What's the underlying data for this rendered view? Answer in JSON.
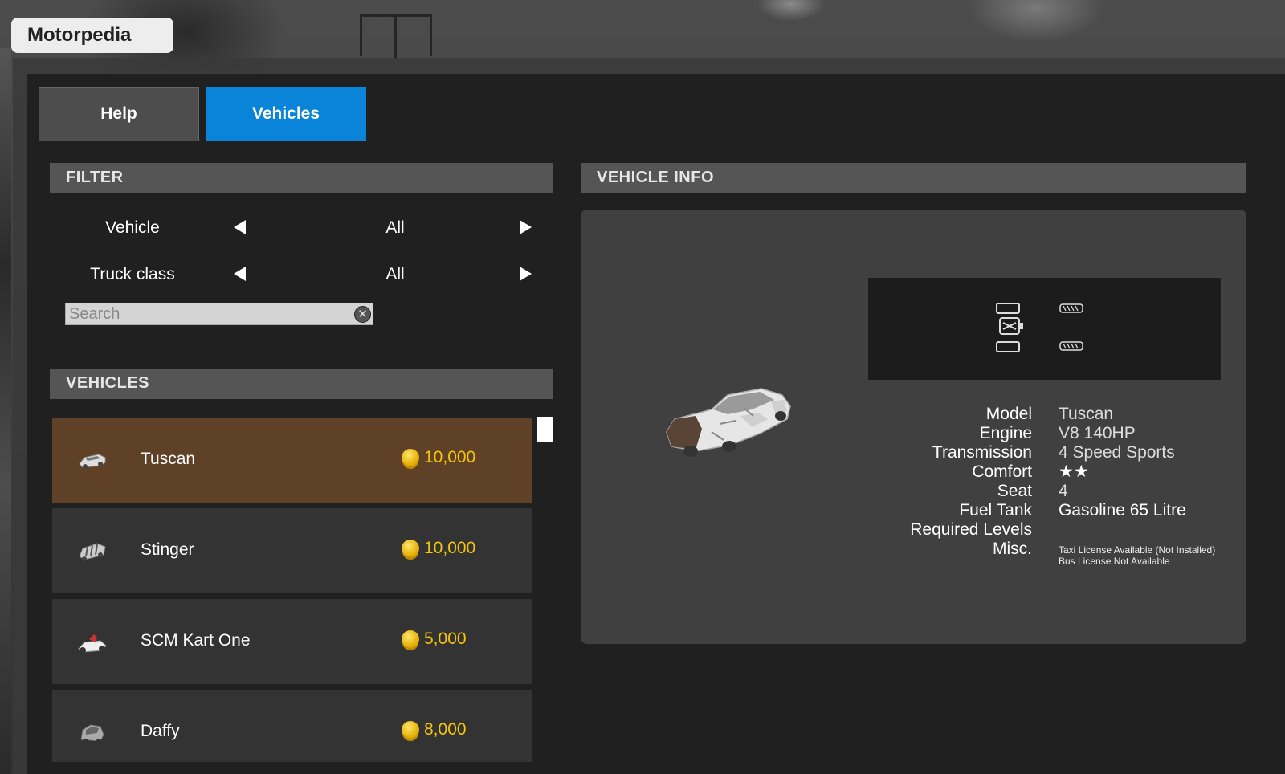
{
  "window": {
    "title": "Motorpedia"
  },
  "tabs": [
    {
      "label": "Help",
      "active": false
    },
    {
      "label": "Vehicles",
      "active": true
    }
  ],
  "filter": {
    "header": "FILTER",
    "rows": [
      {
        "label": "Vehicle",
        "value": "All"
      },
      {
        "label": "Truck class",
        "value": "All"
      }
    ],
    "search_placeholder": "Search"
  },
  "vehicles": {
    "header": "VEHICLES",
    "items": [
      {
        "name": "Tuscan",
        "price": "10,000",
        "selected": true
      },
      {
        "name": "Stinger",
        "price": "10,000",
        "selected": false
      },
      {
        "name": "SCM Kart One",
        "price": "5,000",
        "selected": false
      },
      {
        "name": "Daffy",
        "price": "8,000",
        "selected": false
      }
    ]
  },
  "vehicle_info": {
    "header": "VEHICLE INFO",
    "specs": {
      "model_label": "Model",
      "model": "Tuscan",
      "engine_label": "Engine",
      "engine": "V8 140HP",
      "transmission_label": "Transmission",
      "transmission": "4 Speed Sports",
      "comfort_label": "Comfort",
      "comfort": "★★",
      "seat_label": "Seat",
      "seat": "4",
      "fuel_label": "Fuel Tank",
      "fuel": "Gasoline 65 Litre",
      "levels_label": "Required Levels",
      "levels": "",
      "misc_label": "Misc.",
      "misc_line1": "Taxi License Available (Not Installed)",
      "misc_line2": "Bus License Not Available"
    }
  },
  "colors": {
    "accent": "#0a84d8",
    "selected_row": "#5e4127",
    "price": "#f6c60a"
  }
}
